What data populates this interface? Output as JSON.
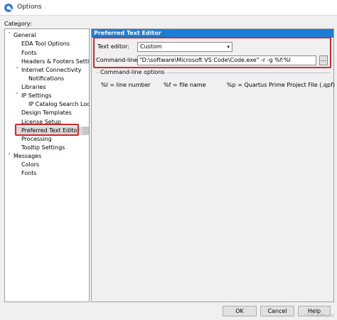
{
  "window": {
    "title": "Options"
  },
  "category_label": "Category:",
  "tree": [
    {
      "label": "General",
      "expanded": true
    },
    {
      "label": "EDA Tool Options"
    },
    {
      "label": "Fonts"
    },
    {
      "label": "Headers & Footers Setting"
    },
    {
      "label": "Internet Connectivity",
      "expanded": true
    },
    {
      "label": "Notifications"
    },
    {
      "label": "Libraries"
    },
    {
      "label": "IP Settings",
      "expanded": true
    },
    {
      "label": "IP Catalog Search Locat"
    },
    {
      "label": "Design Templates"
    },
    {
      "label": "License Setup"
    },
    {
      "label": "Preferred Text Editor",
      "selected": true
    },
    {
      "label": "Processing"
    },
    {
      "label": "Tooltip Settings"
    },
    {
      "label": "Messages",
      "expanded": true
    },
    {
      "label": "Colors"
    },
    {
      "label": "Fonts"
    }
  ],
  "panel": {
    "header": "Preferred Text Editor",
    "text_editor_label": "Text editor:",
    "text_editor_value": "Custom",
    "command_line_label": "Command-line:",
    "command_line_value": "\"D:\\software\\Microsoft VS Code\\Code.exe\" -r -g %f:%l",
    "browse_label": "...",
    "group_title": "Command-line options",
    "vars": {
      "line": "%l = line number",
      "file": "%f = file name",
      "project": "%p = Quartus Prime Project File (.qpf)"
    }
  },
  "buttons": {
    "ok": "OK",
    "cancel": "Cancel",
    "help": "Help"
  },
  "watermark": "CSDN @Win_Luo",
  "colors": {
    "accent": "#1c7cd6",
    "highlight": "#d9262c",
    "selected_bg": "#d9d9d9"
  }
}
